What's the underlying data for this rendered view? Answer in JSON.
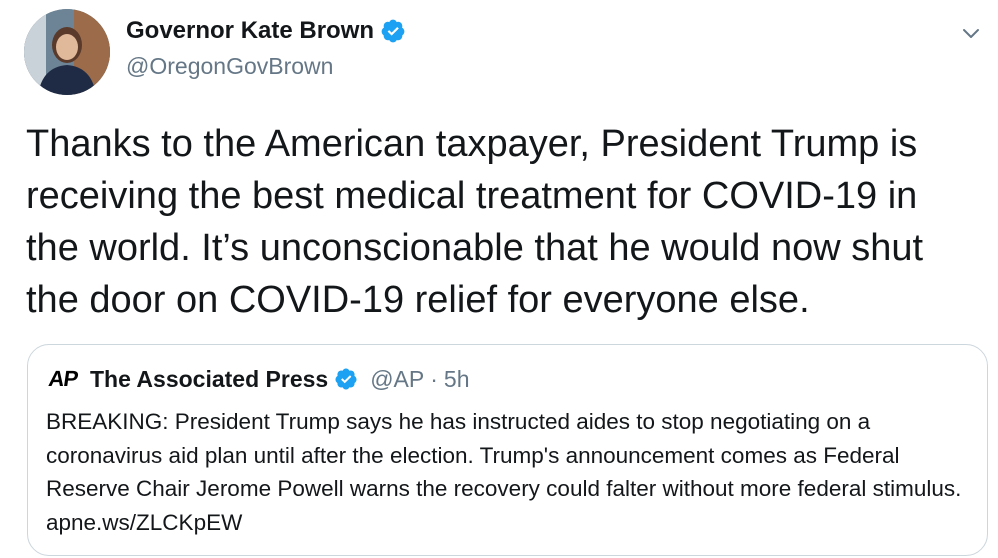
{
  "author": {
    "display_name": "Governor Kate Brown",
    "handle": "@OregonGovBrown",
    "verified": true,
    "avatar_icon": "profile-photo"
  },
  "tweet": {
    "text": "Thanks to the American taxpayer, President Trump is\nreceiving the best medical treatment for COVID-19 in\nthe world. It’s unconscionable that he would now shut\nthe door on COVID-19 relief for everyone else."
  },
  "quoted_tweet": {
    "logo_text": "AP",
    "display_name": "The Associated Press",
    "verified": true,
    "handle": "@AP",
    "separator": "·",
    "time": "5h",
    "text": "BREAKING: President Trump says he has instructed aides to stop negotiating on a coronavirus aid plan until after the election. Trump's announcement comes as Federal Reserve Chair Jerome Powell warns the recovery could falter without more federal stimulus. apne.ws/ZLCKpEW"
  },
  "colors": {
    "text_primary": "#14171a",
    "text_secondary": "#657786",
    "verified_badge": "#1da1f2",
    "border": "#ccd6dd"
  },
  "icons": [
    "verified-badge-icon",
    "chevron-down-icon"
  ]
}
